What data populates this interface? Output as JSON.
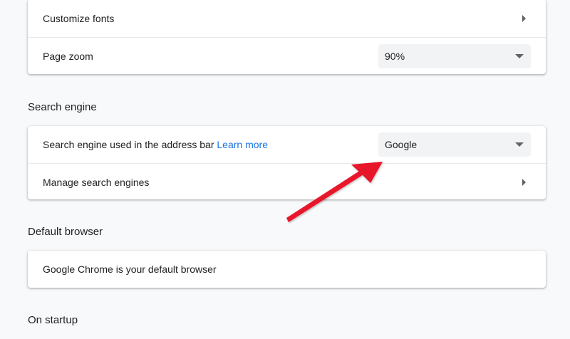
{
  "appearance": {
    "customize_fonts_label": "Customize fonts",
    "page_zoom_label": "Page zoom",
    "page_zoom_value": "90%"
  },
  "search_engine": {
    "section_title": "Search engine",
    "used_in_address_bar_label": "Search engine used in the address bar",
    "learn_more_link": "Learn more",
    "selected_engine": "Google",
    "manage_label": "Manage search engines"
  },
  "default_browser": {
    "section_title": "Default browser",
    "status_text": "Google Chrome is your default browser"
  },
  "on_startup": {
    "section_title": "On startup"
  },
  "annotation": {
    "arrow_color": "#e8192c"
  },
  "colors": {
    "background": "#f8f9fa",
    "card": "#ffffff",
    "link": "#1a73e8",
    "select_background": "#f1f3f4"
  }
}
